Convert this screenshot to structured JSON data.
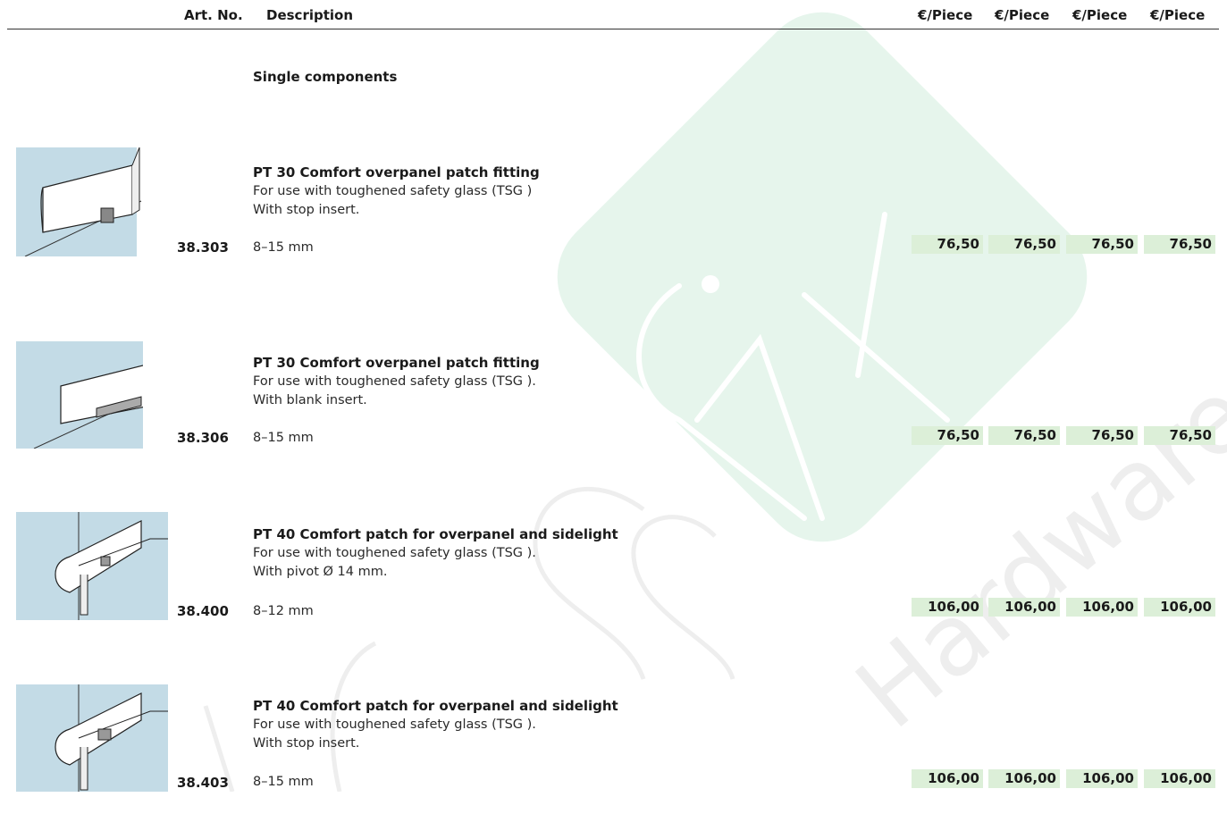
{
  "header": {
    "artno_label": "Art. No.",
    "description_label": "Description",
    "price_labels": [
      "€/Piece",
      "€/Piece",
      "€/Piece",
      "€/Piece"
    ]
  },
  "section": {
    "title": "Single components"
  },
  "products": [
    {
      "title": "PT 30 Comfort overpanel patch fitting",
      "line1": "For use with toughened safety glass (TSG )",
      "line2": "With stop insert.",
      "artno": "38.303",
      "size": "8–15 mm",
      "prices": [
        "76,50",
        "76,50",
        "76,50",
        "76,50"
      ]
    },
    {
      "title": "PT 30 Comfort overpanel patch fitting",
      "line1": "For use with toughened safety glass (TSG ).",
      "line2": "With blank insert.",
      "artno": "38.306",
      "size": "8–15 mm",
      "prices": [
        "76,50",
        "76,50",
        "76,50",
        "76,50"
      ]
    },
    {
      "title": "PT 40 Comfort patch for overpanel and sidelight",
      "line1": "For use with toughened safety glass (TSG ).",
      "line2": "With pivot Ø 14 mm.",
      "artno": "38.400",
      "size": "8–12 mm",
      "prices": [
        "106,00",
        "106,00",
        "106,00",
        "106,00"
      ]
    },
    {
      "title": "PT 40 Comfort patch for overpanel and sidelight",
      "line1": "For use with toughened safety glass (TSG ).",
      "line2": "With stop insert.",
      "artno": "38.403",
      "size": "8–15 mm",
      "prices": [
        "106,00",
        "106,00",
        "106,00",
        "106,00"
      ]
    }
  ],
  "watermark": {
    "text": "TSS Hardware",
    "icon": "fix-logo-mark"
  },
  "colors": {
    "price_bg": "#dcefd8",
    "glass": "#c3dbe6",
    "watermark": "#e3f3ea"
  }
}
